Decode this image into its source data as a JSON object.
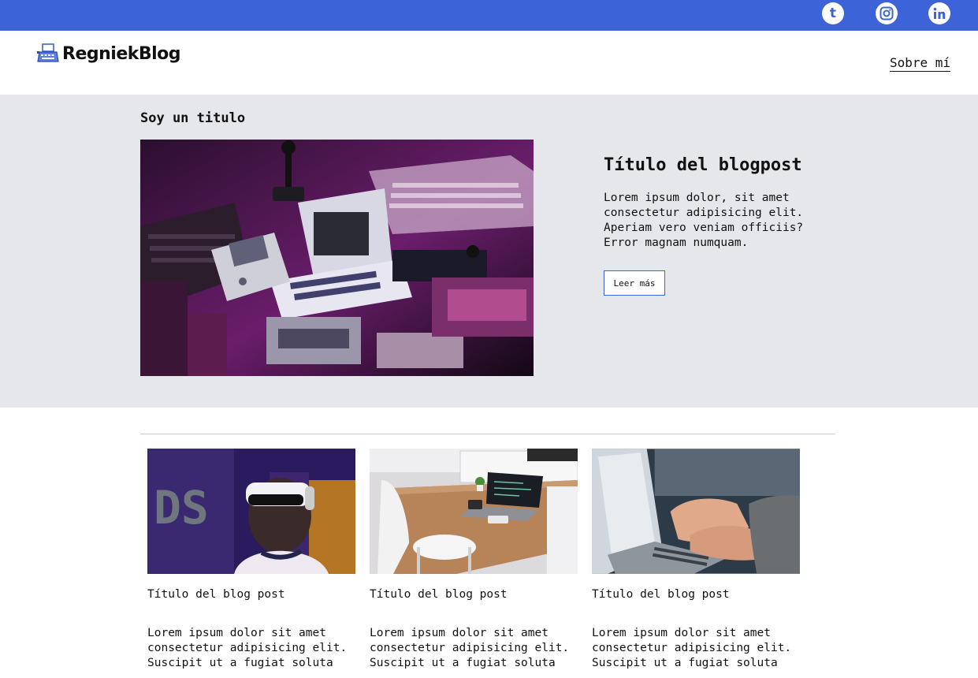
{
  "topbar": {
    "social": [
      {
        "icon": "tumblr-icon",
        "glyph": "t"
      },
      {
        "icon": "instagram-icon"
      },
      {
        "icon": "linkedin-icon"
      }
    ]
  },
  "header": {
    "logo_text": "RegniekBlog",
    "nav": {
      "about_label": "Sobre mí"
    }
  },
  "hero": {
    "section_title": "Soy un titulo",
    "post_title": "Título del blogpost",
    "excerpt": "Lorem ipsum dolor, sit amet consectetur adipisicing elit. Aperiam vero veniam officiis? Error magnam numquam.",
    "read_more_label": "Leer más"
  },
  "posts": [
    {
      "title": "Título del blog post",
      "excerpt": "Lorem ipsum dolor sit amet consectetur adipisicing elit. Suscipit ut a fugiat soluta"
    },
    {
      "title": "Título del blog post",
      "excerpt": "Lorem ipsum dolor sit amet consectetur adipisicing elit. Suscipit ut a fugiat soluta"
    },
    {
      "title": "Título del blog post",
      "excerpt": "Lorem ipsum dolor sit amet consectetur adipisicing elit. Suscipit ut a fugiat soluta"
    }
  ],
  "colors": {
    "accent": "#3d63d8",
    "hero_bg": "#e6e7eb"
  }
}
